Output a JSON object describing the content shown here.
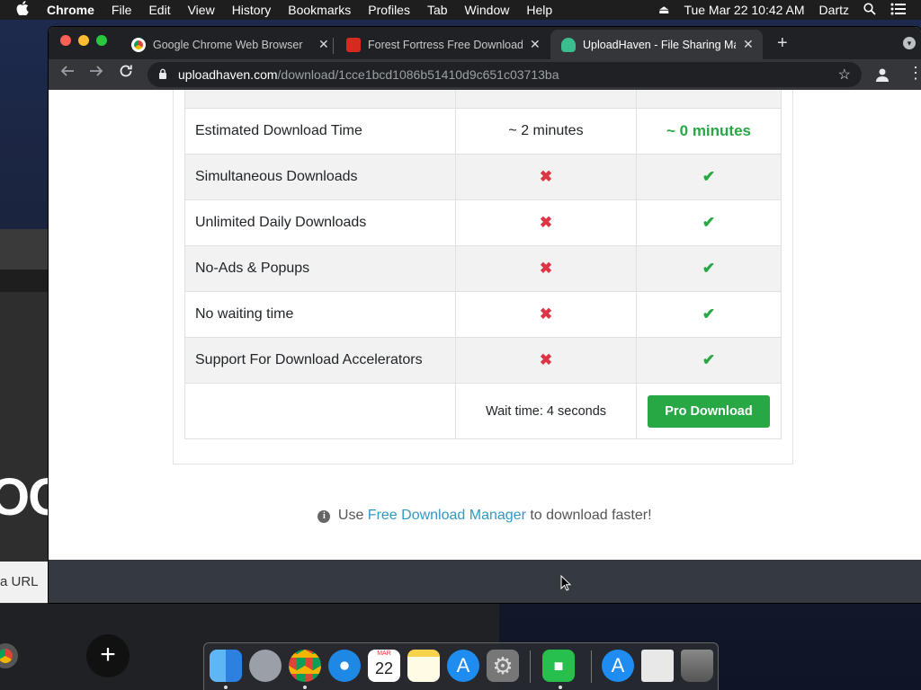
{
  "menubar": {
    "app_name": "Chrome",
    "items": [
      "File",
      "Edit",
      "View",
      "History",
      "Bookmarks",
      "Profiles",
      "Tab",
      "Window",
      "Help"
    ],
    "datetime": "Tue Mar 22  10:42 AM",
    "user": "Dartz"
  },
  "browser": {
    "tabs": [
      {
        "title": "Google Chrome Web Browser",
        "favicon": "chrome-icon",
        "active": false
      },
      {
        "title": "Forest Fortress Free Download",
        "favicon": "game-icon",
        "active": false
      },
      {
        "title": "UploadHaven - File Sharing Made",
        "favicon": "cloud-icon",
        "active": true
      }
    ],
    "url_domain": "uploadhaven.com",
    "url_path": "/download/1cce1bcd1086b51410d9c651c03713ba"
  },
  "comparison": {
    "rows": [
      {
        "feature": "Estimated Download Time",
        "free": "~ 2 minutes",
        "pro": "~ 0 minutes",
        "kind": "text"
      },
      {
        "feature": "Simultaneous Downloads",
        "free": "✖",
        "pro": "✔",
        "kind": "mark"
      },
      {
        "feature": "Unlimited Daily Downloads",
        "free": "✖",
        "pro": "✔",
        "kind": "mark"
      },
      {
        "feature": "No-Ads & Popups",
        "free": "✖",
        "pro": "✔",
        "kind": "mark"
      },
      {
        "feature": "No waiting time",
        "free": "✖",
        "pro": "✔",
        "kind": "mark"
      },
      {
        "feature": "Support For Download Accelerators",
        "free": "✖",
        "pro": "✔",
        "kind": "mark"
      }
    ],
    "wait_text": "Wait time: 4 seconds",
    "pro_button": "Pro Download"
  },
  "tip": {
    "prefix": "Use",
    "link": "Free Download Manager",
    "suffix": "to download faster!"
  },
  "background": {
    "partial_url_text": "a URL",
    "partial_big_text": "OO"
  },
  "dock": {
    "calendar_month": "MAR",
    "calendar_day": "22"
  },
  "colors": {
    "success": "#28a745",
    "danger": "#dc3545",
    "link": "#2f9ac7"
  }
}
